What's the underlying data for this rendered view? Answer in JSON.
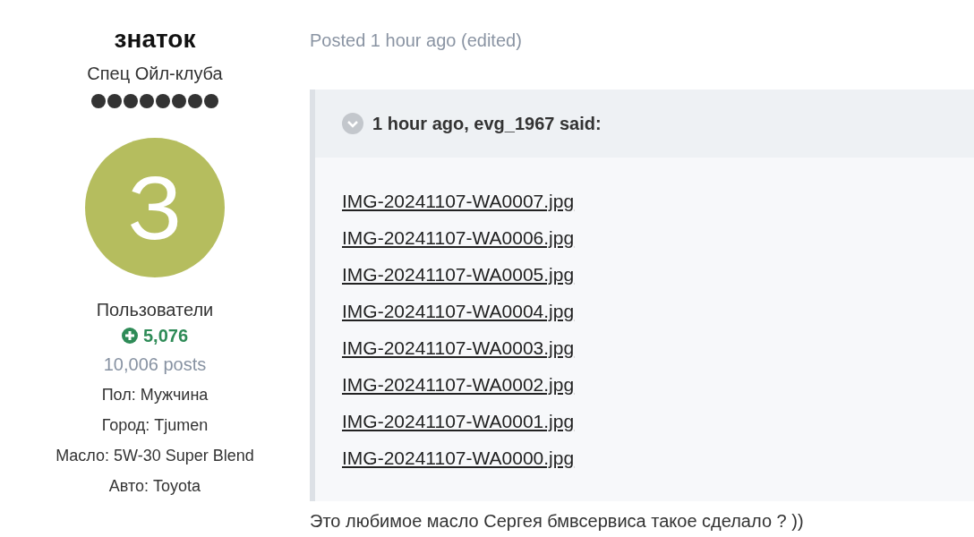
{
  "author": {
    "name": "знаток",
    "title": "Спец Ойл-клуба",
    "avatar_letter": "З",
    "group": "Пользователи",
    "reputation": "5,076",
    "posts": "10,006 posts",
    "fields": [
      {
        "label": "Пол:",
        "value": "Мужчина"
      },
      {
        "label": "Город:",
        "value": "Tjumen"
      },
      {
        "label": "Масло:",
        "value": "5W-30 Super Blend"
      },
      {
        "label": "Авто:",
        "value": "Toyota"
      }
    ]
  },
  "post": {
    "meta": "Posted 1 hour ago (edited)",
    "quote": {
      "citation": "1 hour ago, evg_1967 said:",
      "attachments": [
        "IMG-20241107-WA0007.jpg",
        "IMG-20241107-WA0006.jpg",
        "IMG-20241107-WA0005.jpg",
        "IMG-20241107-WA0004.jpg",
        "IMG-20241107-WA0003.jpg",
        "IMG-20241107-WA0002.jpg",
        "IMG-20241107-WA0001.jpg",
        "IMG-20241107-WA0000.jpg"
      ]
    },
    "text": "Это любимое масло Сергея бмвсервиса такое сделало ? ))"
  }
}
